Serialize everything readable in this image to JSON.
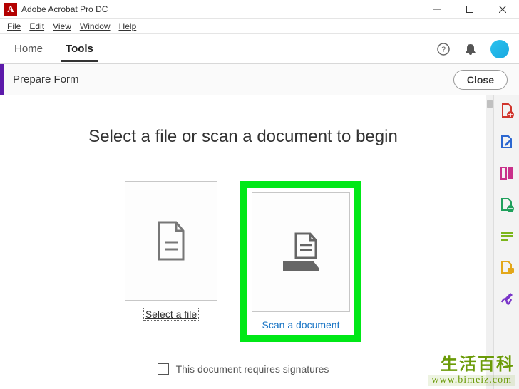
{
  "titleBar": {
    "appIconLetter": "A",
    "appTitle": "Adobe Acrobat Pro DC"
  },
  "menuBar": {
    "items": [
      {
        "label": "File",
        "underlineIdx": 0
      },
      {
        "label": "Edit",
        "underlineIdx": 0
      },
      {
        "label": "View",
        "underlineIdx": 0
      },
      {
        "label": "Window",
        "underlineIdx": 0
      },
      {
        "label": "Help",
        "underlineIdx": 0
      }
    ]
  },
  "mainNav": {
    "tabs": [
      {
        "label": "Home",
        "active": false
      },
      {
        "label": "Tools",
        "active": true
      }
    ]
  },
  "subHeader": {
    "title": "Prepare Form",
    "closeLabel": "Close"
  },
  "content": {
    "heading": "Select a file or scan a document to begin",
    "options": {
      "selectFile": {
        "label": "Select a file"
      },
      "scanDocument": {
        "label": "Scan a document"
      }
    },
    "signatures": {
      "label": "This document requires signatures",
      "checked": false
    }
  },
  "rightRail": {
    "tools": [
      {
        "name": "create-pdf",
        "color": "#d0342c"
      },
      {
        "name": "edit-pdf",
        "color": "#2c67d0"
      },
      {
        "name": "export-pdf",
        "color": "#c9308a"
      },
      {
        "name": "organize-pages",
        "color": "#1fa05c"
      },
      {
        "name": "enhance-scans",
        "color": "#7bb51a"
      },
      {
        "name": "comment",
        "color": "#e3a71a"
      },
      {
        "name": "fill-sign",
        "color": "#7a35c9"
      },
      {
        "name": "more-tools",
        "color": "#8a8a8a"
      }
    ]
  },
  "watermark": {
    "line1": "生活百科",
    "line2": "www.bimeiz.com"
  }
}
